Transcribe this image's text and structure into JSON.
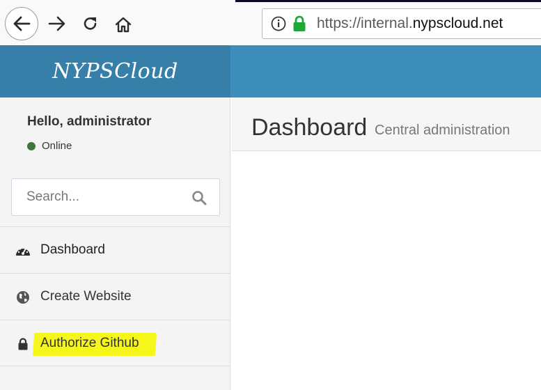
{
  "browser": {
    "url_prefix": "https://internal.",
    "url_host": "nypscloud.net",
    "icons": {
      "back": "back-arrow-icon",
      "forward": "forward-arrow-icon",
      "reload": "reload-icon",
      "home": "home-icon",
      "info": "info-icon",
      "secure": "lock-icon"
    },
    "secure_color": "#1ea838"
  },
  "app": {
    "brand": "NYPSCloud",
    "header_color": "#3c8dbc",
    "brand_bg_color": "#367fa9"
  },
  "user_panel": {
    "greeting": "Hello, administrator",
    "status": "Online",
    "status_color": "#3c763d"
  },
  "search": {
    "placeholder": "Search..."
  },
  "menu": {
    "items": [
      {
        "label": "Dashboard",
        "icon": "dashboard-gauge-icon"
      },
      {
        "label": "Create Website",
        "icon": "globe-icon"
      },
      {
        "label": "Authorize Github",
        "icon": "lock-icon",
        "highlighted": true,
        "highlight_color": "#f6f61a"
      }
    ]
  },
  "content": {
    "title": "Dashboard",
    "subtitle": "Central administration"
  }
}
